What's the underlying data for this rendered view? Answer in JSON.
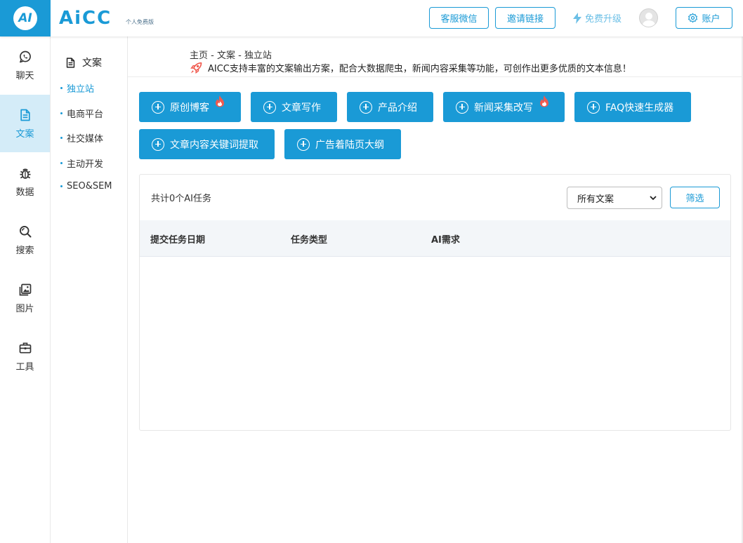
{
  "header": {
    "logo_letter": "AI",
    "brand": "AiCC",
    "brand_sub": "个人免费版",
    "customer_service_label": "客服微信",
    "invite_label": "邀请链接",
    "upgrade_label": "免费升级",
    "account_label": "账户"
  },
  "nav": {
    "items": [
      {
        "label": "聊天",
        "icon": "chat-icon"
      },
      {
        "label": "文案",
        "icon": "document-icon",
        "active": true
      },
      {
        "label": "数据",
        "icon": "bug-icon"
      },
      {
        "label": "搜索",
        "icon": "search-icon"
      },
      {
        "label": "图片",
        "icon": "images-icon"
      },
      {
        "label": "工具",
        "icon": "toolbox-icon"
      }
    ]
  },
  "submenu": {
    "title": "文案",
    "items": [
      {
        "label": "独立站",
        "active": true
      },
      {
        "label": "电商平台"
      },
      {
        "label": "社交媒体"
      },
      {
        "label": "主动开发"
      },
      {
        "label": "SEO&SEM"
      }
    ]
  },
  "breadcrumb": "主页 - 文案 - 独立站",
  "description": "AICC支持丰富的文案输出方案，配合大数据爬虫，新闻内容采集等功能，可创作出更多优质的文本信息！",
  "actions": [
    {
      "label": "原创博客",
      "hot": true
    },
    {
      "label": "文章写作"
    },
    {
      "label": "产品介绍"
    },
    {
      "label": "新闻采集改写",
      "hot": true
    },
    {
      "label": "FAQ快速生成器"
    },
    {
      "label": "文章内容关键词提取"
    },
    {
      "label": "广告着陆页大纲"
    }
  ],
  "tasks": {
    "count_text": "共计0个AI任务",
    "filter_select": "所有文案",
    "filter_button": "筛选",
    "columns": [
      "提交任务日期",
      "任务类型",
      "AI需求"
    ],
    "rows": []
  },
  "colors": {
    "accent": "#1a9ad6",
    "active_nav_bg": "#d4ecf8",
    "fire": "#f05a4f"
  }
}
